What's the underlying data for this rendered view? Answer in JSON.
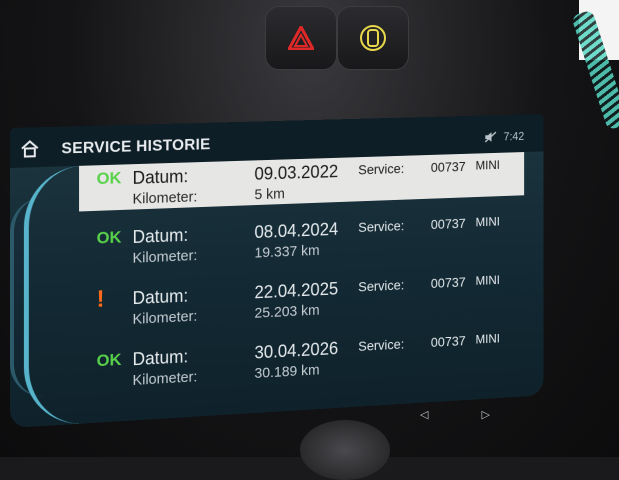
{
  "screen": {
    "title": "SERVICE HISTORIE",
    "time": "7:42"
  },
  "labels": {
    "date": "Datum:",
    "km": "Kilometer:",
    "service": "Service:"
  },
  "entries": [
    {
      "status": "OK",
      "date": "09.03.2022",
      "km": "5 km",
      "code": "00737",
      "model": "MINI",
      "selected": true
    },
    {
      "status": "OK",
      "date": "08.04.2024",
      "km": "19.337 km",
      "code": "00737",
      "model": "MINI",
      "selected": false
    },
    {
      "status": "!",
      "date": "22.04.2025",
      "km": "25.203 km",
      "code": "00737",
      "model": "MINI",
      "selected": false
    },
    {
      "status": "OK",
      "date": "30.04.2026",
      "km": "30.189 km",
      "code": "00737",
      "model": "MINI",
      "selected": false
    }
  ],
  "colors": {
    "ok": "#58d24a",
    "warn": "#ff6a1a",
    "hazard": "#e02828",
    "accent": "#5fc4dc"
  },
  "icons": {
    "home": "home-icon",
    "hazard": "hazard-triangle-icon",
    "lock": "car-lock-icon",
    "mute": "mute-icon",
    "prev": "triangle-left-icon",
    "next": "triangle-right-icon"
  }
}
